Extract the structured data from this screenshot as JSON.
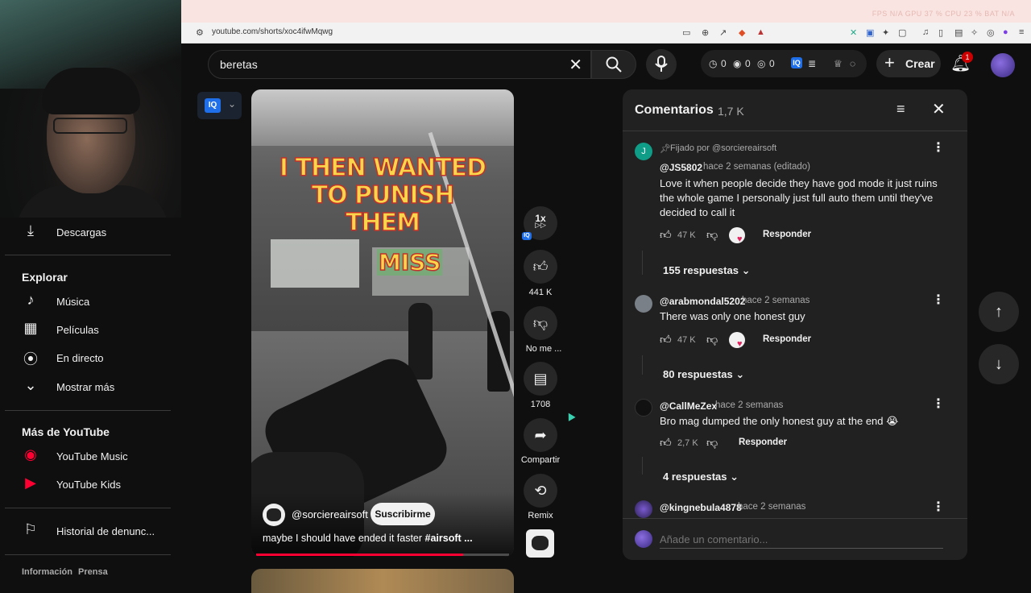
{
  "browser": {
    "url": "youtube.com/shorts/xoc4ifwMqwg",
    "stats": "FPS N/A   GPU 37 %   CPU 23 %   BAT N/A"
  },
  "header": {
    "search_value": "beretas",
    "crear_label": "Crear",
    "notification_count": "1",
    "ext_counts": [
      "0",
      "0",
      "0"
    ]
  },
  "sidebar": {
    "descargas": "Descargas",
    "explorar_heading": "Explorar",
    "explore_items": [
      {
        "label": "Música",
        "icon": "music-note-icon"
      },
      {
        "label": "Películas",
        "icon": "film-icon"
      },
      {
        "label": "En directo",
        "icon": "live-broadcast-icon"
      },
      {
        "label": "Mostrar más",
        "icon": "chevron-down-icon"
      }
    ],
    "more_heading": "Más de YouTube",
    "more_items": [
      {
        "label": "YouTube Music",
        "icon": "youtube-music-icon"
      },
      {
        "label": "YouTube Kids",
        "icon": "youtube-kids-icon"
      }
    ],
    "report_history": "Historial de denunc...",
    "footer_links": [
      "Información",
      "Prensa"
    ]
  },
  "video": {
    "caption_lines": [
      "I THEN WANTED",
      "TO PUNISH",
      "THEM"
    ],
    "caption_miss": "MISS",
    "channel": "@sorciereairsoft",
    "subscribe_label": "Suscribirme",
    "title": "maybe I should have ended it faster",
    "hashtag": "#airsoft ...",
    "progress": 0.82
  },
  "actions": {
    "speed": "1x",
    "likes": "441 K",
    "dislike_label": "No me ...",
    "comments": "1708",
    "share_label": "Compartir",
    "remix_label": "Remix"
  },
  "comments": {
    "title": "Comentarios",
    "count": "1,7 K",
    "reply_label": "Responder",
    "input_placeholder": "Añade un comentario...",
    "items": [
      {
        "pinned": "Fijado por @sorciereairsoft",
        "avatar_letter": "J",
        "user": "@JS5802",
        "time": "hace 2 semanas (editado)",
        "text": "Love it when people decide they have god mode it just ruins the whole game I personally just full auto them until they've decided to call it",
        "likes": "47 K",
        "replies": "155 respuestas"
      },
      {
        "user": "@arabmondal5202",
        "time": "hace 2 semanas",
        "text": "There was only one honest guy",
        "likes": "47 K",
        "replies": "80 respuestas"
      },
      {
        "user": "@CallMeZex",
        "time": "hace 2 semanas",
        "text": "Bro mag dumped the only honest guy at the end 😭",
        "likes": "2,7 K",
        "replies": "4 respuestas"
      },
      {
        "user": "@kingnebula4878",
        "time": "hace 2 semanas"
      }
    ]
  }
}
